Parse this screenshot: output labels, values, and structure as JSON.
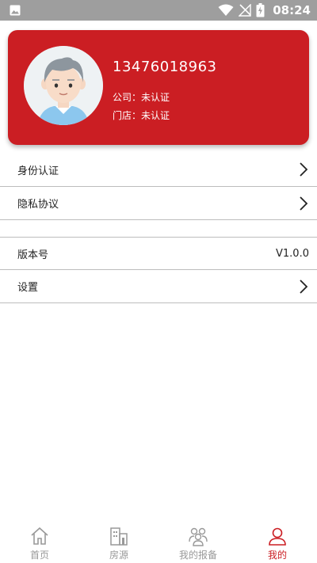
{
  "status_bar": {
    "time": "08:24",
    "icons": [
      "gallery-icon",
      "wifi-icon",
      "no-signal-icon",
      "battery-charging-icon"
    ]
  },
  "profile": {
    "phone": "13476018963",
    "company": "公司：未认证",
    "store": "门店：未认证",
    "card_color": "#cb1e23"
  },
  "menu": {
    "identity_verification": "身份认证",
    "privacy_agreement": "隐私协议",
    "version_label": "版本号",
    "version_value": "V1.0.0",
    "settings": "设置"
  },
  "tab_bar": {
    "items": [
      {
        "label": "首页",
        "icon": "home-icon",
        "active": false
      },
      {
        "label": "房源",
        "icon": "building-icon",
        "active": false
      },
      {
        "label": "我的报备",
        "icon": "people-icon",
        "active": false
      },
      {
        "label": "我的",
        "icon": "person-icon",
        "active": true
      }
    ],
    "active_color": "#cb1e23",
    "inactive_color": "#999999"
  }
}
